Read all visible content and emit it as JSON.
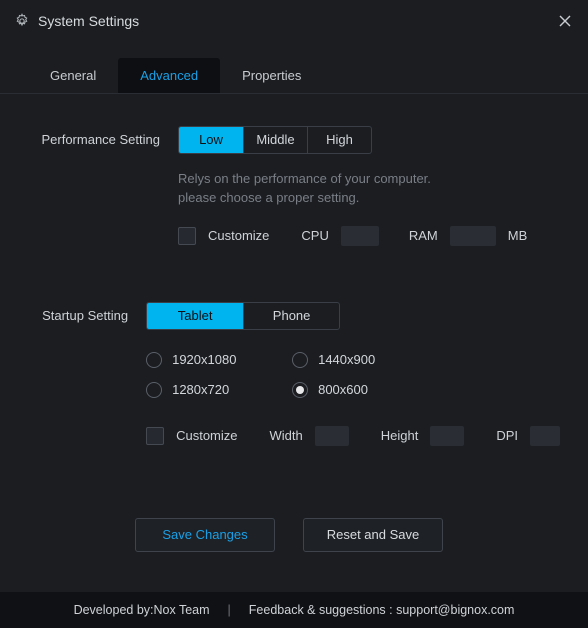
{
  "window": {
    "title": "System Settings"
  },
  "tabs": {
    "general": "General",
    "advanced": "Advanced",
    "properties": "Properties"
  },
  "performance": {
    "label": "Performance Setting",
    "low": "Low",
    "middle": "Middle",
    "high": "High",
    "hint_line1": "Relys on the performance of your computer.",
    "hint_line2": "please choose a proper setting.",
    "customize": "Customize",
    "cpu": "CPU",
    "ram": "RAM",
    "mb": "MB"
  },
  "startup": {
    "label": "Startup Setting",
    "tablet": "Tablet",
    "phone": "Phone",
    "res1": "1920x1080",
    "res2": "1440x900",
    "res3": "1280x720",
    "res4": "800x600",
    "customize": "Customize",
    "width": "Width",
    "height": "Height",
    "dpi": "DPI"
  },
  "buttons": {
    "save": "Save Changes",
    "reset": "Reset and Save"
  },
  "footer": {
    "developed": "Developed by:Nox Team",
    "sep": "|",
    "feedback": "Feedback & suggestions : support@bignox.com"
  }
}
